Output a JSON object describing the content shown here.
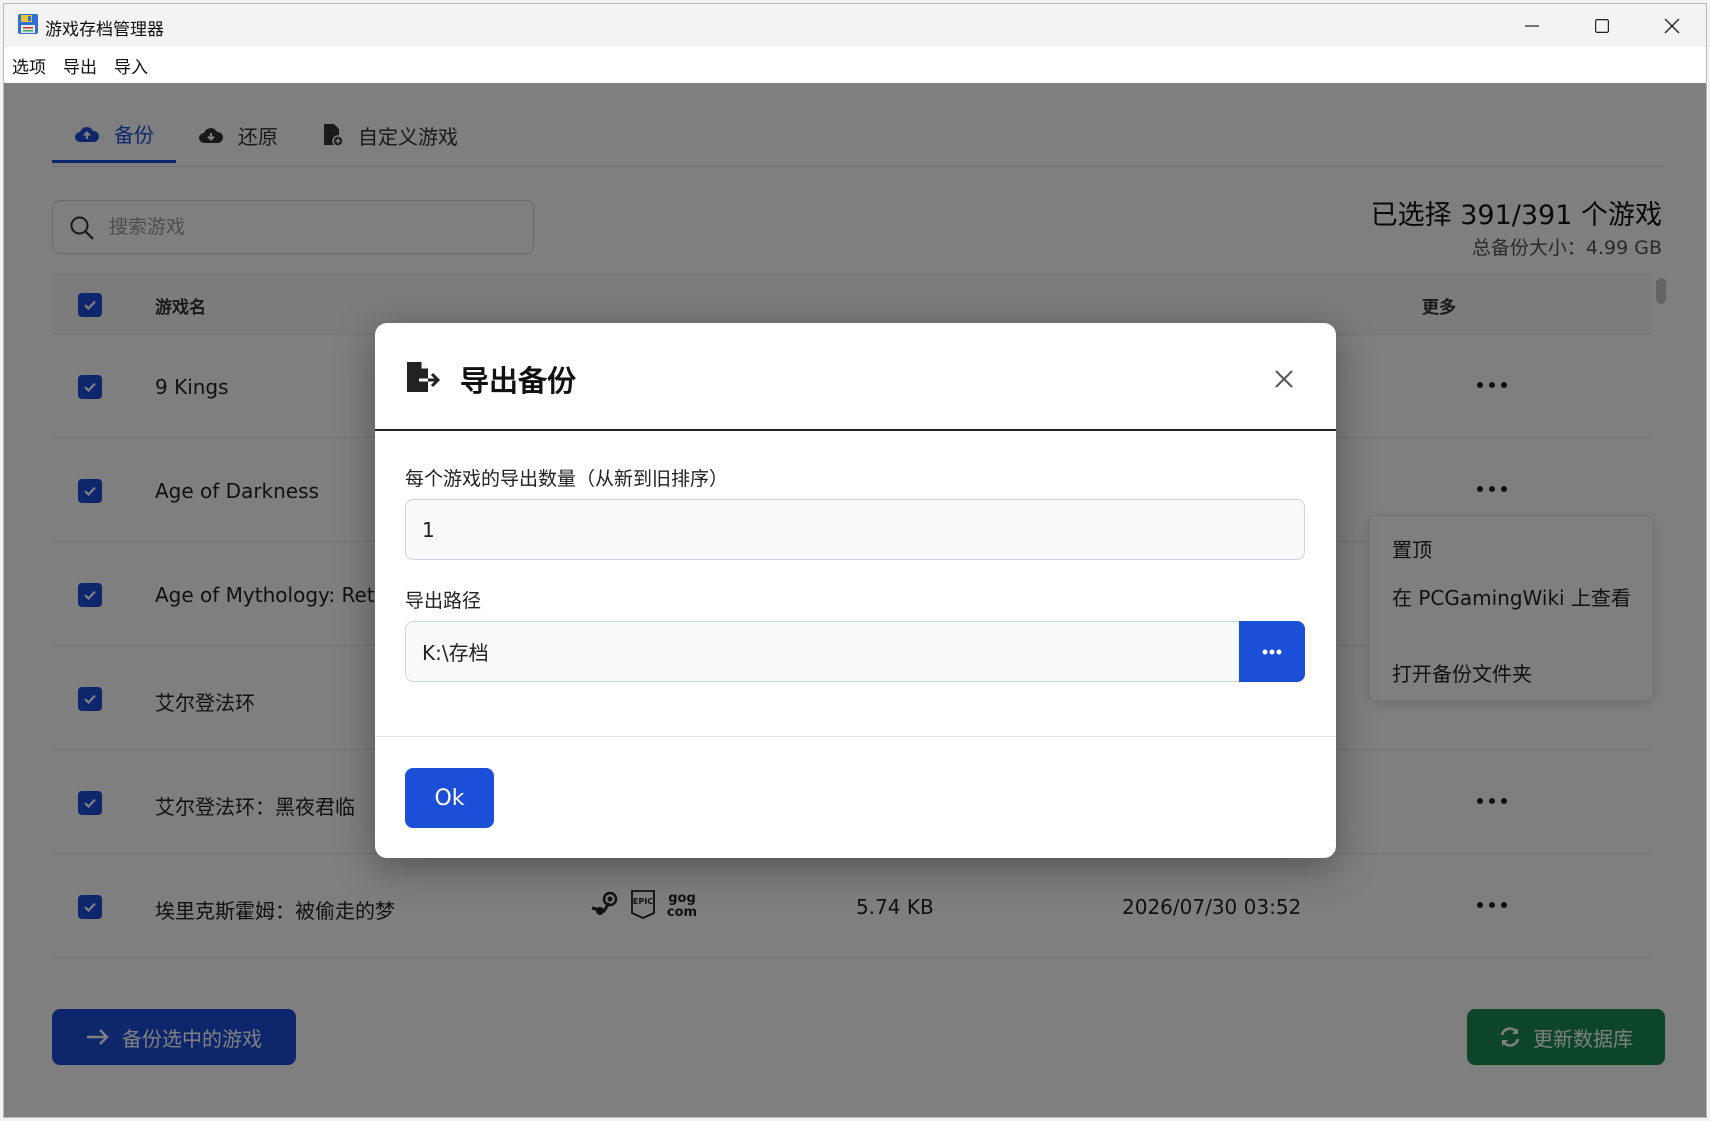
{
  "window": {
    "title": "游戏存档管理器"
  },
  "menubar": {
    "items": [
      "选项",
      "导出",
      "导入"
    ]
  },
  "tabs": [
    {
      "label": "备份",
      "icon": "cloud-upload-icon",
      "active": true
    },
    {
      "label": "还原",
      "icon": "cloud-download-icon",
      "active": false
    },
    {
      "label": "自定义游戏",
      "icon": "file-plus-icon",
      "active": false
    }
  ],
  "search": {
    "placeholder": "搜索游戏",
    "value": ""
  },
  "summary": {
    "selected": "已选择 391/391 个游戏",
    "total_size": "总备份大小：4.99 GB"
  },
  "table": {
    "columns": {
      "name": "游戏名",
      "more": "更多"
    },
    "rows": [
      {
        "name": "9 Kings",
        "size": "",
        "date": ""
      },
      {
        "name": "Age of Darkness",
        "size": "",
        "date": ""
      },
      {
        "name": "Age of Mythology: Ret",
        "size": "",
        "date": ""
      },
      {
        "name": "艾尔登法环",
        "size": "",
        "date": ""
      },
      {
        "name": "艾尔登法环：黑夜君临",
        "size": "",
        "date": ""
      },
      {
        "name": "埃里克斯霍姆：被偷走的梦",
        "size": "5.74 KB",
        "date": "2026/07/30 03:52",
        "platforms": [
          "steam-icon",
          "epic-icon",
          "gog-icon"
        ]
      }
    ]
  },
  "context_menu": {
    "items": [
      "置顶",
      "在 PCGamingWiki 上查看",
      "打开备份文件夹"
    ]
  },
  "buttons": {
    "backup": "备份选中的游戏",
    "update": "更新数据库"
  },
  "modal": {
    "title": "导出备份",
    "count_label": "每个游戏的导出数量（从新到旧排序）",
    "count_value": "1",
    "path_label": "导出路径",
    "path_value": "K:\\存档",
    "ok": "Ok"
  },
  "colors": {
    "primary": "#1c4fd8",
    "success": "#1a8a55"
  }
}
